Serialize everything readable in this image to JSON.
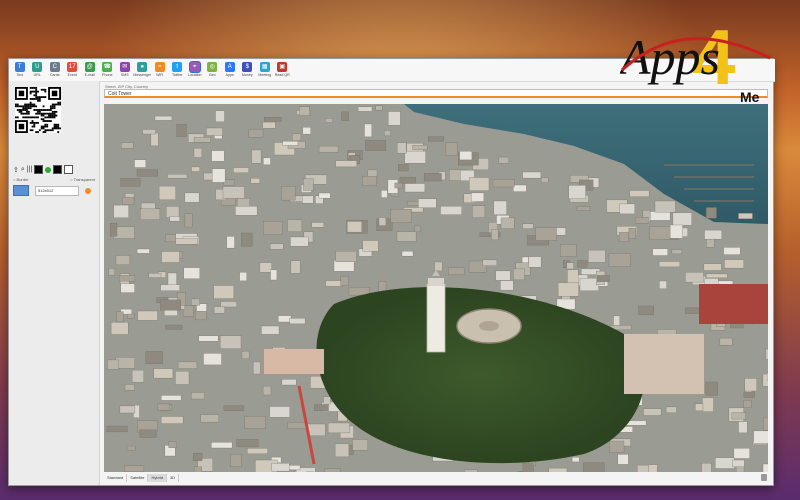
{
  "toolbar": {
    "items": [
      {
        "label": "Text",
        "color": "#3c7dd9",
        "glyph": "T"
      },
      {
        "label": "URL",
        "color": "#2a9d8f",
        "glyph": "U"
      },
      {
        "label": "Cards",
        "color": "#6b7b8c",
        "glyph": "C"
      },
      {
        "label": "Event",
        "color": "#e34b3b",
        "glyph": "17"
      },
      {
        "label": "E-mail",
        "color": "#3a9b4a",
        "glyph": "@"
      },
      {
        "label": "Phone",
        "color": "#4caf50",
        "glyph": "☎"
      },
      {
        "label": "SMS",
        "color": "#8e44ad",
        "glyph": "✉"
      },
      {
        "label": "Messenger",
        "color": "#2f9e9e",
        "glyph": "●"
      },
      {
        "label": "WiFi",
        "color": "#f08d22",
        "glyph": "≈"
      },
      {
        "label": "Twitter",
        "color": "#1da1f2",
        "glyph": "t"
      },
      {
        "label": "Location",
        "color": "#9b59b6",
        "glyph": "⌖"
      },
      {
        "label": "Geo",
        "color": "#7cb342",
        "glyph": "◎"
      },
      {
        "label": "Apps",
        "color": "#2979ff",
        "glyph": "A"
      },
      {
        "label": "Money",
        "color": "#3f51b5",
        "glyph": "$"
      },
      {
        "label": "Meeting",
        "color": "#26a6d1",
        "glyph": "▦"
      },
      {
        "label": "Read QR",
        "color": "#c0392b",
        "glyph": "▣"
      }
    ],
    "active": "Location"
  },
  "sidebar": {
    "options": [
      "Border",
      "Transparent"
    ],
    "size_value": "512x512"
  },
  "search": {
    "address": "Street, ZIP City, Country",
    "value": "Coit Tower"
  },
  "map": {
    "tabs": [
      "Standard",
      "Satellite",
      "Hybrid",
      "3D"
    ],
    "active_tab": "Hybrid"
  },
  "logo": {
    "text": "Apps",
    "number": "4",
    "sub": "Me"
  }
}
